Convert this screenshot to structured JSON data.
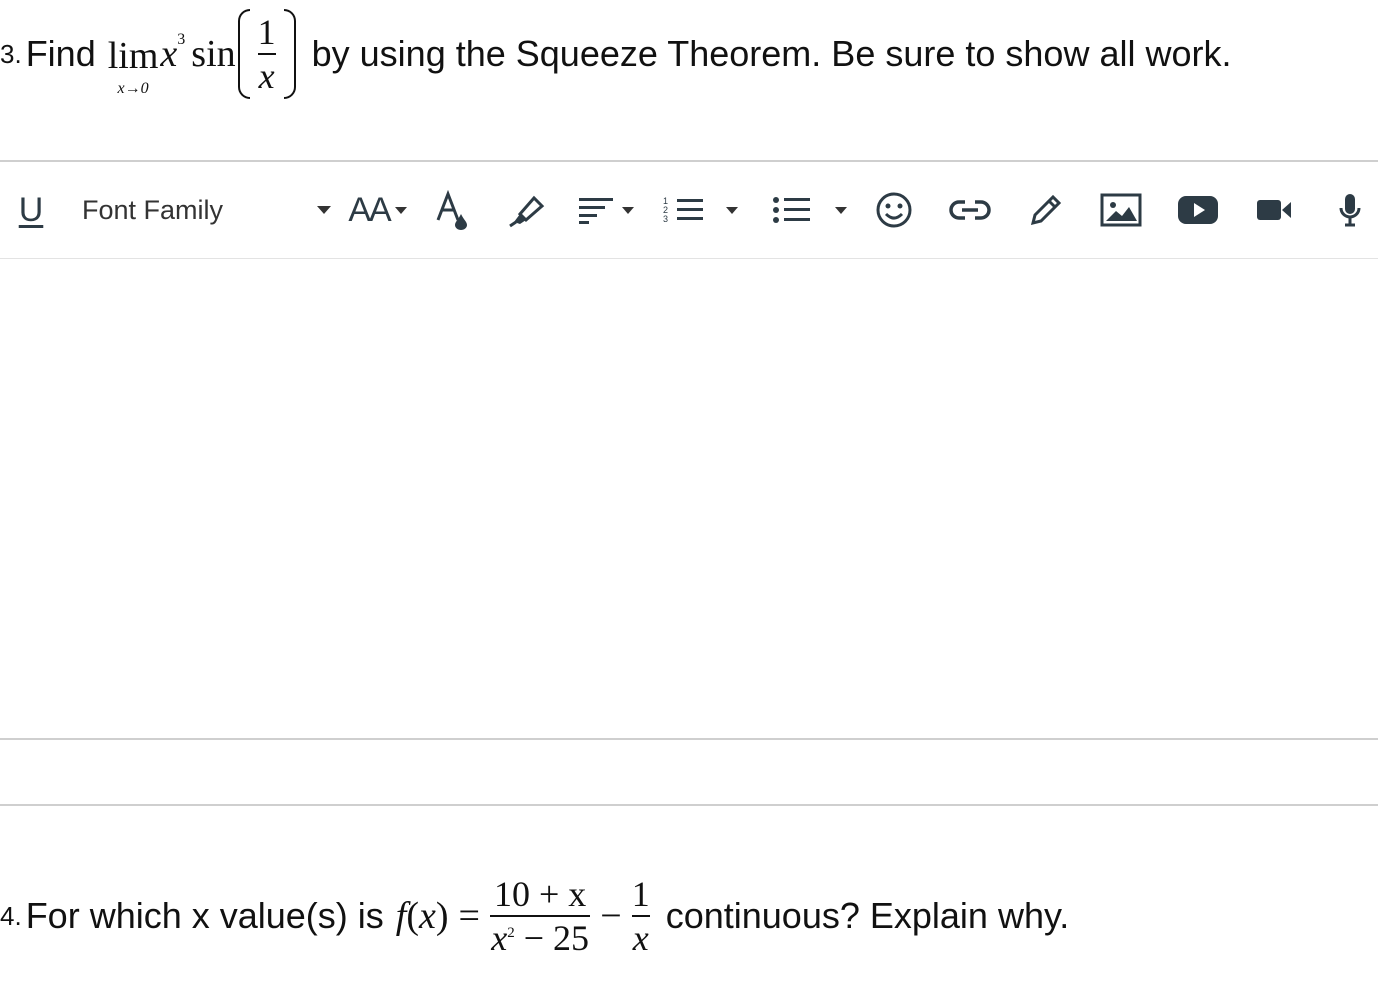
{
  "q3": {
    "number": "3.",
    "prefix": "Find",
    "lim": "lim",
    "lim_sub": "x→0",
    "var": "x",
    "exp": "3",
    "fn": "sin",
    "frac_num": "1",
    "frac_den": "x",
    "suffix": "by using the Squeeze Theorem. Be sure to show all work."
  },
  "toolbar": {
    "underline": "U",
    "font_family": "Font Family",
    "font_size": "AA",
    "list_numbers": "1 2 3"
  },
  "q4": {
    "number": "4.",
    "prefix": "For which x value(s) is",
    "fn": "f",
    "var": "x",
    "paren_open": "(",
    "paren_close": ")",
    "eq": "=",
    "num1": "10 + x",
    "den1_var": "x",
    "den1_exp": "2",
    "den1_rest": "− 25",
    "minus": "−",
    "num2": "1",
    "den2": "x",
    "suffix": "continuous?  Explain why."
  }
}
